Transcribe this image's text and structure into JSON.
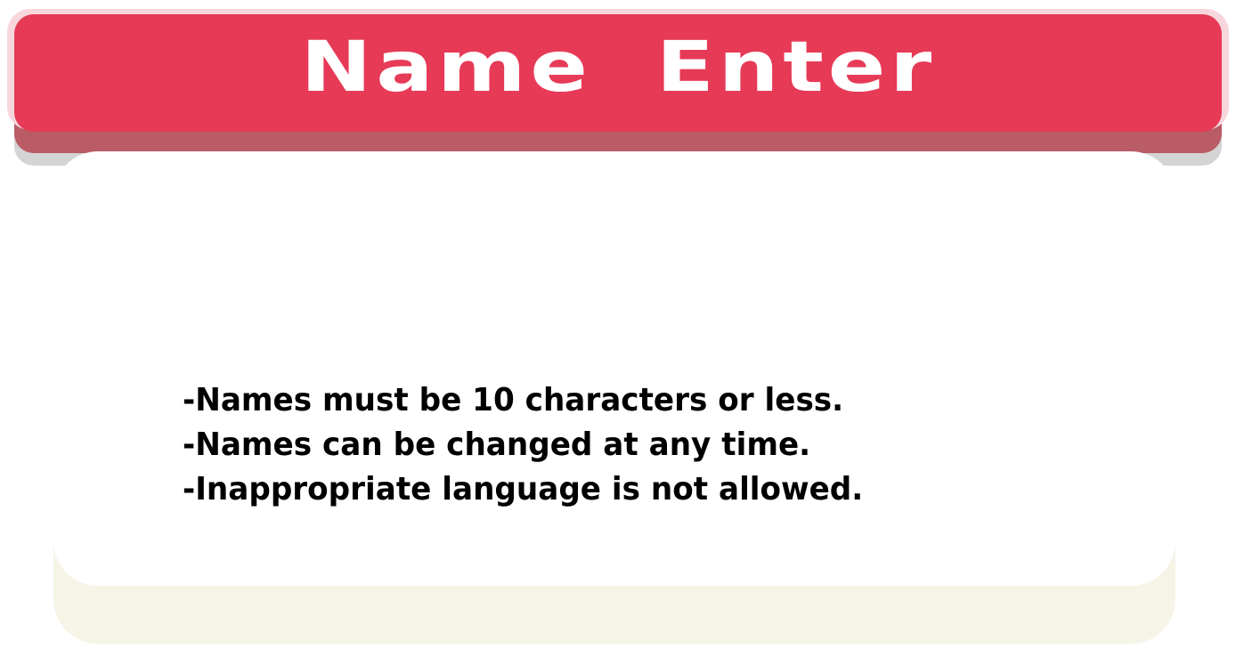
{
  "header": {
    "title": "Name Enter"
  },
  "rules": {
    "items": [
      "-Names must be 10 characters or less.",
      "-Names can be changed at any time.",
      "-Inappropriate language is not allowed."
    ]
  },
  "colors": {
    "header_bg": "#e63a57",
    "header_depth": "#b95c66",
    "panel_bg": "#ffffff",
    "panel_base": "#f6f4e6",
    "text": "#000000"
  }
}
